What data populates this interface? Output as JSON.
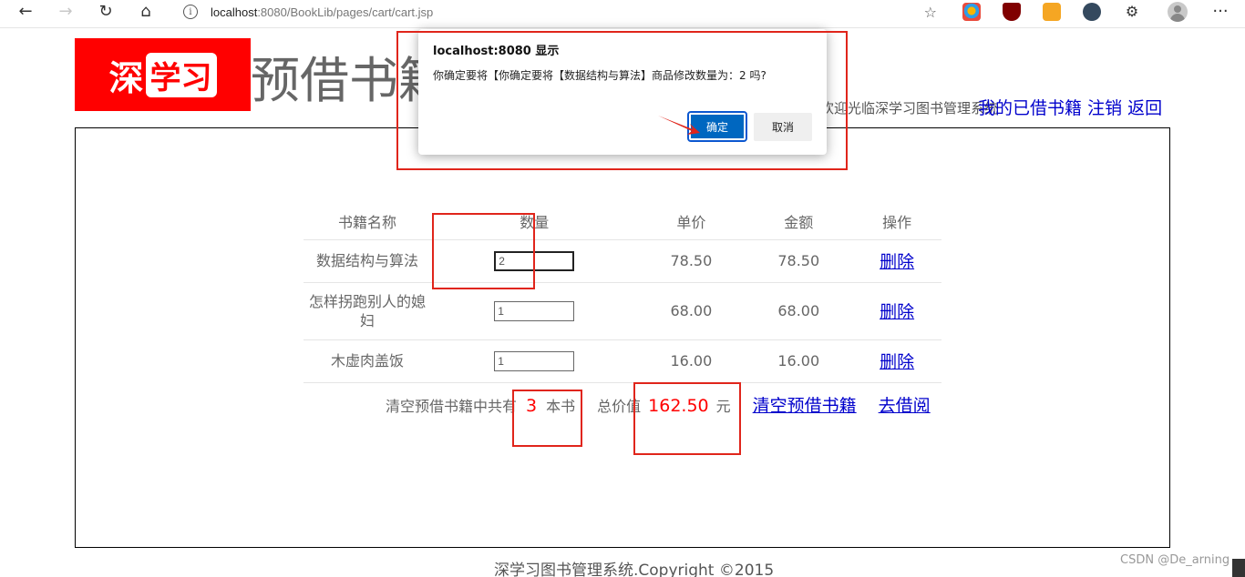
{
  "browser": {
    "url_host": "localhost",
    "url_path": ":8080/BookLib/pages/cart/cart.jsp",
    "back_icon": "←",
    "forward_icon": "→",
    "reload_icon": "↻",
    "home_icon": "⌂",
    "info_icon": "i",
    "favorites_icon": "☆",
    "more_icon": "···",
    "extensions_icon": "⚙"
  },
  "header": {
    "logo_part1": "深",
    "logo_part2": "学习",
    "title": "预借书籍",
    "welcome": "欢迎光临深学习图书管理系统",
    "links": {
      "my_books": "我的已借书籍",
      "logout": "注销",
      "back": "返回"
    }
  },
  "cart": {
    "columns": [
      "书籍名称",
      "数量",
      "单价",
      "金额",
      "操作"
    ],
    "rows": [
      {
        "name": "数据结构与算法",
        "qty": "2",
        "price": "78.50",
        "amount": "78.50",
        "action": "删除"
      },
      {
        "name": "怎样拐跑别人的媳妇",
        "qty": "1",
        "price": "68.00",
        "amount": "68.00",
        "action": "删除"
      },
      {
        "name": "木虚肉盖饭",
        "qty": "1",
        "price": "16.00",
        "amount": "16.00",
        "action": "删除"
      }
    ],
    "summary": {
      "prefix": "清空预借书籍中共有",
      "count": "3",
      "unit": "本书",
      "total_label": "总价值",
      "total": "162.50",
      "currency": "元",
      "clear_link": "清空预借书籍",
      "borrow_link": "去借阅"
    }
  },
  "dialog": {
    "title": "localhost:8080 显示",
    "message": "你确定要将【你确定要将【数据结构与算法】商品修改数量为：2 吗?",
    "ok_label": "确定",
    "cancel_label": "取消"
  },
  "footer": {
    "copyright": "深学习图书管理系统.Copyright ©2015",
    "watermark": "CSDN @De_arning"
  },
  "colors": {
    "logo_bg": "#ff0000",
    "link": "#0000cc",
    "highlight": "#e0251b",
    "ok_button": "#0067c0"
  }
}
